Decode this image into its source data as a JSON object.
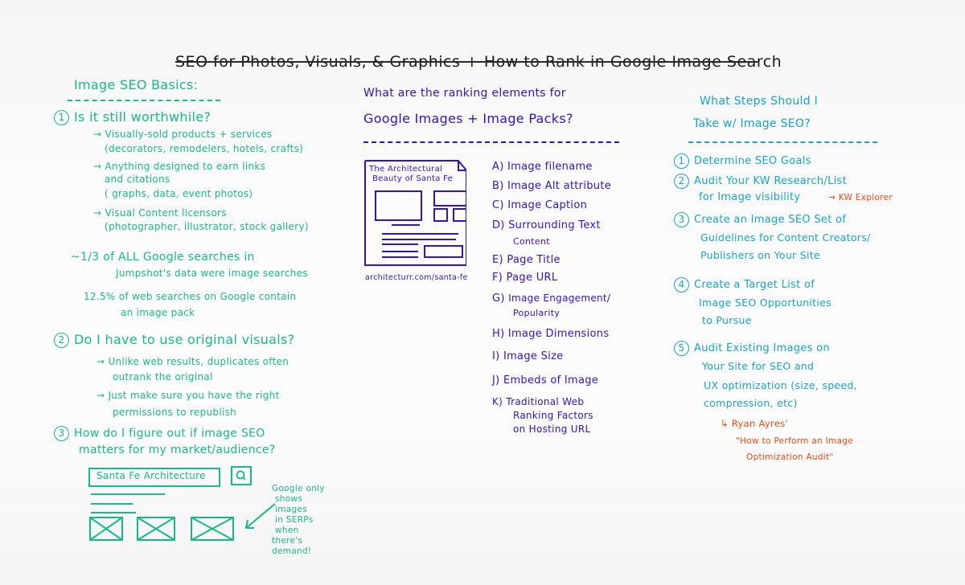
{
  "title": "SEO for Photos, Visuals, & Graphics + How to Rank in Google Image Search",
  "colors": {
    "title": "#1a1a1a",
    "left_column": "#17b98a",
    "middle_column": "#3412c9",
    "right_column": "#14a5c8",
    "annotations": "#f04a12",
    "board": "#fbfbfb"
  },
  "left": {
    "heading": "Image SEO Basics:",
    "q1": {
      "number": "1",
      "question": "Is it still worthwhile?",
      "points": [
        {
          "line1": "→ Visually-sold products + services",
          "line2": "(decorators, remodelers, hotels, crafts)"
        },
        {
          "line1": "→ Anything designed to earn links",
          "line2": "and citations",
          "line3": "( graphs, data, event photos)"
        },
        {
          "line1": "→ Visual Content licensors",
          "line2": "(photographer, illustrator, stock gallery)"
        }
      ],
      "stat1_line1": "~1/3 of ALL Google searches in",
      "stat1_line2": "Jumpshot's data were image searches",
      "stat2_line1": "12.5% of web searches on Google contain",
      "stat2_line2": "an image pack"
    },
    "q2": {
      "number": "2",
      "question": "Do I have to use original visuals?",
      "points": [
        {
          "line1": "→ Unlike web results, duplicates often",
          "line2": "outrank the original"
        },
        {
          "line1": "→ Just make sure you have the right",
          "line2": "permissions to republish"
        }
      ]
    },
    "q3": {
      "number": "3",
      "line1": "How do I figure out if image SEO",
      "line2": "matters for my market/audience?"
    },
    "search_sketch": {
      "query": "Santa Fe Architecture",
      "search_icon": "magnifier-icon",
      "note_lines": [
        "Google only",
        "shows images",
        "in SERPs when",
        "there's demand!"
      ]
    }
  },
  "middle": {
    "heading_line1": "What are the ranking elements for",
    "heading_line2": "Google Images + Image Packs?",
    "page_sketch": {
      "title_line1": "The Architectural",
      "title_line2": "Beauty of Santa Fe",
      "url": "architecturr.com/santa-fe"
    },
    "elements": [
      {
        "letter": "A)",
        "lines": [
          "Image filename"
        ]
      },
      {
        "letter": "B)",
        "lines": [
          "Image Alt attribute"
        ]
      },
      {
        "letter": "C)",
        "lines": [
          "Image Caption"
        ]
      },
      {
        "letter": "D)",
        "lines": [
          "Surrounding Text",
          "Content"
        ]
      },
      {
        "letter": "E)",
        "lines": [
          "Page Title"
        ]
      },
      {
        "letter": "F)",
        "lines": [
          "Page URL"
        ]
      },
      {
        "letter": "G)",
        "lines": [
          "Image Engagement/",
          "Popularity"
        ]
      },
      {
        "letter": "H)",
        "lines": [
          "Image Dimensions"
        ]
      },
      {
        "letter": "I)",
        "lines": [
          "Image Size"
        ]
      },
      {
        "letter": "J)",
        "lines": [
          "Embeds of Image"
        ]
      },
      {
        "letter": "K)",
        "lines": [
          "Traditional Web",
          "Ranking Factors",
          "on Hosting URL"
        ]
      }
    ]
  },
  "right": {
    "heading_line1": "What Steps Should I",
    "heading_line2": "Take w/ Image SEO?",
    "steps": [
      {
        "number": "1",
        "lines": [
          "Determine SEO Goals"
        ]
      },
      {
        "number": "2",
        "lines": [
          "Audit Your KW Research/List",
          "for Image visibility"
        ],
        "annotation": "→ KW Explorer"
      },
      {
        "number": "3",
        "lines": [
          "Create an Image SEO Set of",
          "Guidelines for Content Creators/",
          "Publishers on Your Site"
        ]
      },
      {
        "number": "4",
        "lines": [
          "Create a Target List of",
          "Image SEO Opportunities",
          "to Pursue"
        ]
      },
      {
        "number": "5",
        "lines": [
          "Audit Existing Images on",
          "Your Site for SEO and",
          "UX optimization (size, speed,",
          "compression, etc)"
        ]
      }
    ],
    "reference": {
      "line1": "↳ Ryan Ayres'",
      "line2": "\"How to Perform an Image",
      "line3": "Optimization Audit\""
    }
  }
}
